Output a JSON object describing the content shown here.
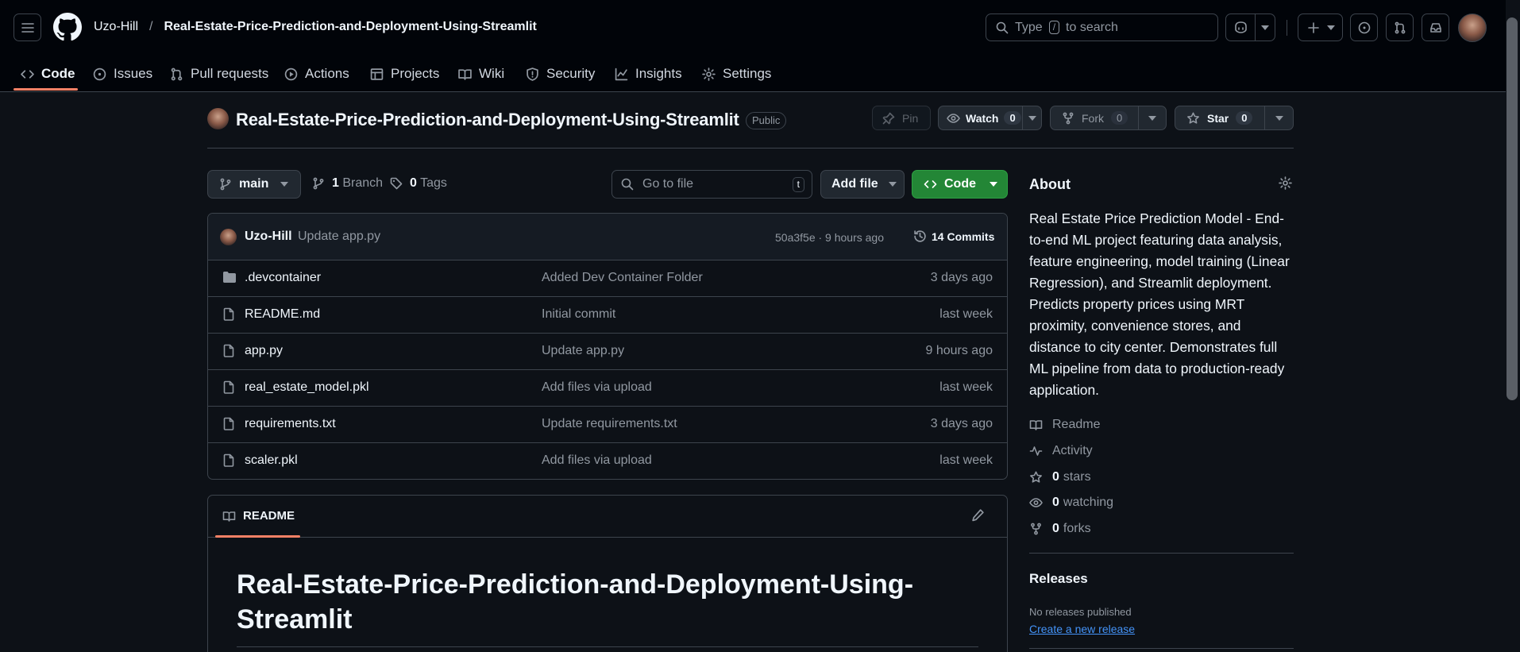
{
  "header": {
    "owner": "Uzo-Hill",
    "separator": "/",
    "repo": "Real-Estate-Price-Prediction-and-Deployment-Using-Streamlit",
    "search": {
      "prefix": "Type",
      "key": "/",
      "suffix": "to search"
    }
  },
  "tabs": [
    {
      "label": "Code",
      "icon": "code-icon"
    },
    {
      "label": "Issues",
      "icon": "issue-icon"
    },
    {
      "label": "Pull requests",
      "icon": "pull-request-icon"
    },
    {
      "label": "Actions",
      "icon": "play-icon"
    },
    {
      "label": "Projects",
      "icon": "table-icon"
    },
    {
      "label": "Wiki",
      "icon": "book-icon"
    },
    {
      "label": "Security",
      "icon": "shield-icon"
    },
    {
      "label": "Insights",
      "icon": "graph-icon"
    },
    {
      "label": "Settings",
      "icon": "gear-icon"
    }
  ],
  "repo": {
    "title": "Real-Estate-Price-Prediction-and-Deployment-Using-Streamlit",
    "visibility": "Public",
    "pin_label": "Pin",
    "watch_label": "Watch",
    "watch_count": "0",
    "fork_label": "Fork",
    "fork_count": "0",
    "star_label": "Star",
    "star_count": "0"
  },
  "toolbar": {
    "branch": "main",
    "branch_count": "1",
    "branch_label": "Branch",
    "tag_count": "0",
    "tag_label": "Tags",
    "goto_placeholder": "Go to file",
    "goto_key": "t",
    "add_file_label": "Add file",
    "code_label": "Code"
  },
  "commit": {
    "author": "Uzo-Hill",
    "message": "Update app.py",
    "hash_time": "50a3f5e · 9 hours ago",
    "commits_label": "14 Commits"
  },
  "files": [
    {
      "name": ".devcontainer",
      "type": "folder",
      "message": "Added Dev Container Folder",
      "date": "3 days ago"
    },
    {
      "name": "README.md",
      "type": "file",
      "message": "Initial commit",
      "date": "last week"
    },
    {
      "name": "app.py",
      "type": "file",
      "message": "Update app.py",
      "date": "9 hours ago"
    },
    {
      "name": "real_estate_model.pkl",
      "type": "file",
      "message": "Add files via upload",
      "date": "last week"
    },
    {
      "name": "requirements.txt",
      "type": "file",
      "message": "Update requirements.txt",
      "date": "3 days ago"
    },
    {
      "name": "scaler.pkl",
      "type": "file",
      "message": "Add files via upload",
      "date": "last week"
    }
  ],
  "readme": {
    "tab_label": "README",
    "heading": "Real-Estate-Price-Prediction-and-Deployment-Using-Streamlit"
  },
  "about": {
    "title": "About",
    "description": "Real Estate Price Prediction Model - End-to-end ML project featuring data analysis, feature engineering, model training (Linear Regression), and Streamlit deployment. Predicts property prices using MRT proximity, convenience stores, and distance to city center. Demonstrates full ML pipeline from data to production-ready application.",
    "readme_label": "Readme",
    "activity_label": "Activity",
    "stars_count": "0",
    "stars_label": "stars",
    "watching_count": "0",
    "watching_label": "watching",
    "forks_count": "0",
    "forks_label": "forks"
  },
  "releases": {
    "title": "Releases",
    "empty_text": "No releases published",
    "create_link": "Create a new release"
  },
  "colors": {
    "accent": "#f78166",
    "green": "#238636",
    "link": "#4493f8",
    "bg": "#0d1117",
    "header_bg": "#010409"
  }
}
